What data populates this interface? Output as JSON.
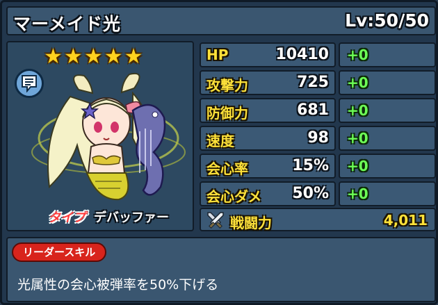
{
  "header": {
    "name": "マーメイド光",
    "level": "Lv:50/50"
  },
  "portrait": {
    "stars": [
      "★",
      "★",
      "★",
      "★",
      "★"
    ],
    "star_count": 5,
    "memo_icon": "memo-icon",
    "type_label": "タイプ",
    "type_value": "デバッファー"
  },
  "stats": [
    {
      "label": "HP",
      "value": "10410",
      "bonus": "+0"
    },
    {
      "label": "攻撃力",
      "value": "725",
      "bonus": "+0"
    },
    {
      "label": "防御力",
      "value": "681",
      "bonus": "+0"
    },
    {
      "label": "速度",
      "value": "98",
      "bonus": "+0"
    },
    {
      "label": "会心率",
      "value": "15%",
      "bonus": "+0"
    },
    {
      "label": "会心ダメ",
      "value": "50%",
      "bonus": "+0"
    }
  ],
  "power": {
    "label": "戦闘力",
    "value": "4,011",
    "icon": "crossed-swords-icon"
  },
  "leader_skill": {
    "badge": "リーダースキル",
    "text": "光属性の会心被弾率を50%下げる"
  },
  "colors": {
    "stat_label": "#ffe23a",
    "bonus": "#6dff57",
    "badge": "#d8241c",
    "panel": "#3b5975"
  }
}
